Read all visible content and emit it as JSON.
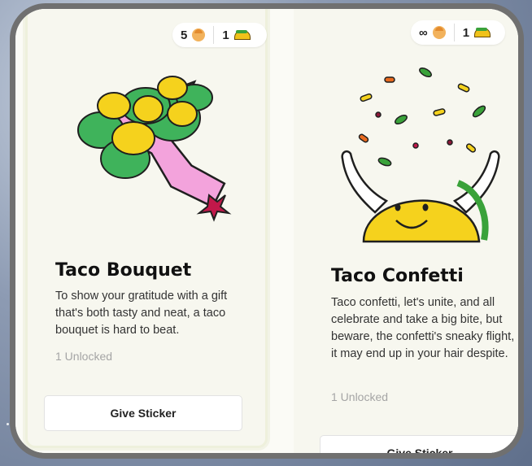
{
  "cards": [
    {
      "sent_count": "5",
      "taco_count": "1",
      "title": "Taco Bouquet",
      "description": "To show your gratitude with a gift that's both tasty and neat, a taco bouquet is hard to beat.",
      "unlocked": "1 Unlocked",
      "button": "Give Sticker"
    },
    {
      "sent_count": "∞",
      "taco_count": "1",
      "title": "Taco Confetti",
      "description": "Taco confetti, let's unite, and all celebrate and take a big bite, but beware, the confetti's sneaky flight, it may end up in your hair despite.",
      "unlocked": "1 Unlocked",
      "button": "Give Sticker"
    }
  ],
  "icons": {
    "person": "person-face-icon",
    "taco": "taco-icon",
    "bouquet": "taco-bouquet-illustration",
    "confetti": "taco-confetti-illustration"
  },
  "colors": {
    "card_bg": "#f7f7ef",
    "taco_yellow": "#f5d21d",
    "wrap_pink": "#f3a3dc",
    "ribbon_red": "#c2184a"
  }
}
